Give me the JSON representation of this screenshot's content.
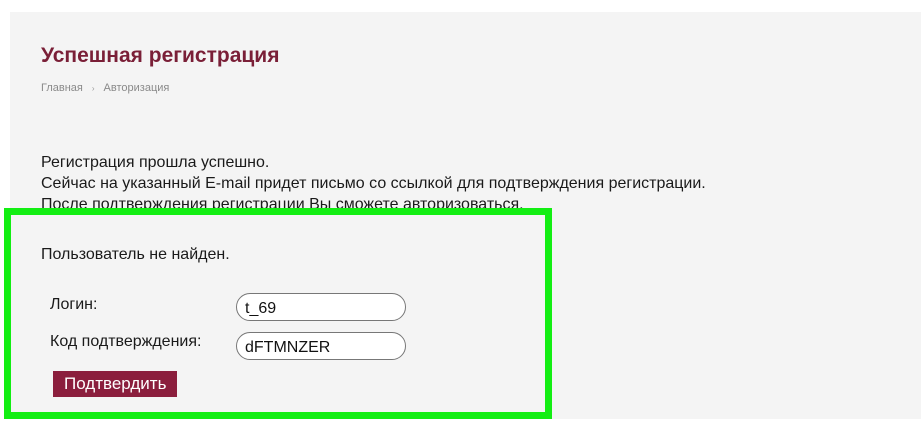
{
  "page": {
    "title": "Успешная регистрация",
    "breadcrumb": [
      {
        "label": "Главная"
      },
      {
        "label": "Авторизация"
      }
    ],
    "breadcrumb_separator": "›"
  },
  "message": {
    "lines": [
      "Регистрация прошла успешно.",
      "Сейчас на указанный E-mail придет письмо со ссылкой для подтверждения регистрации.",
      "После подтверждения регистрации Вы сможете авторизоваться."
    ]
  },
  "confirm_form": {
    "notice": "Пользователь не найден.",
    "login_label": "Логин:",
    "login_value": "t_69",
    "code_label": "Код подтверждения:",
    "code_value": "dFTMNZER",
    "submit_label": "Подтвердить"
  },
  "colors": {
    "title": "#7a1f37",
    "button": "#8b1e3d",
    "highlight_border": "#13ee13",
    "panel_background": "#f4f4f4"
  }
}
